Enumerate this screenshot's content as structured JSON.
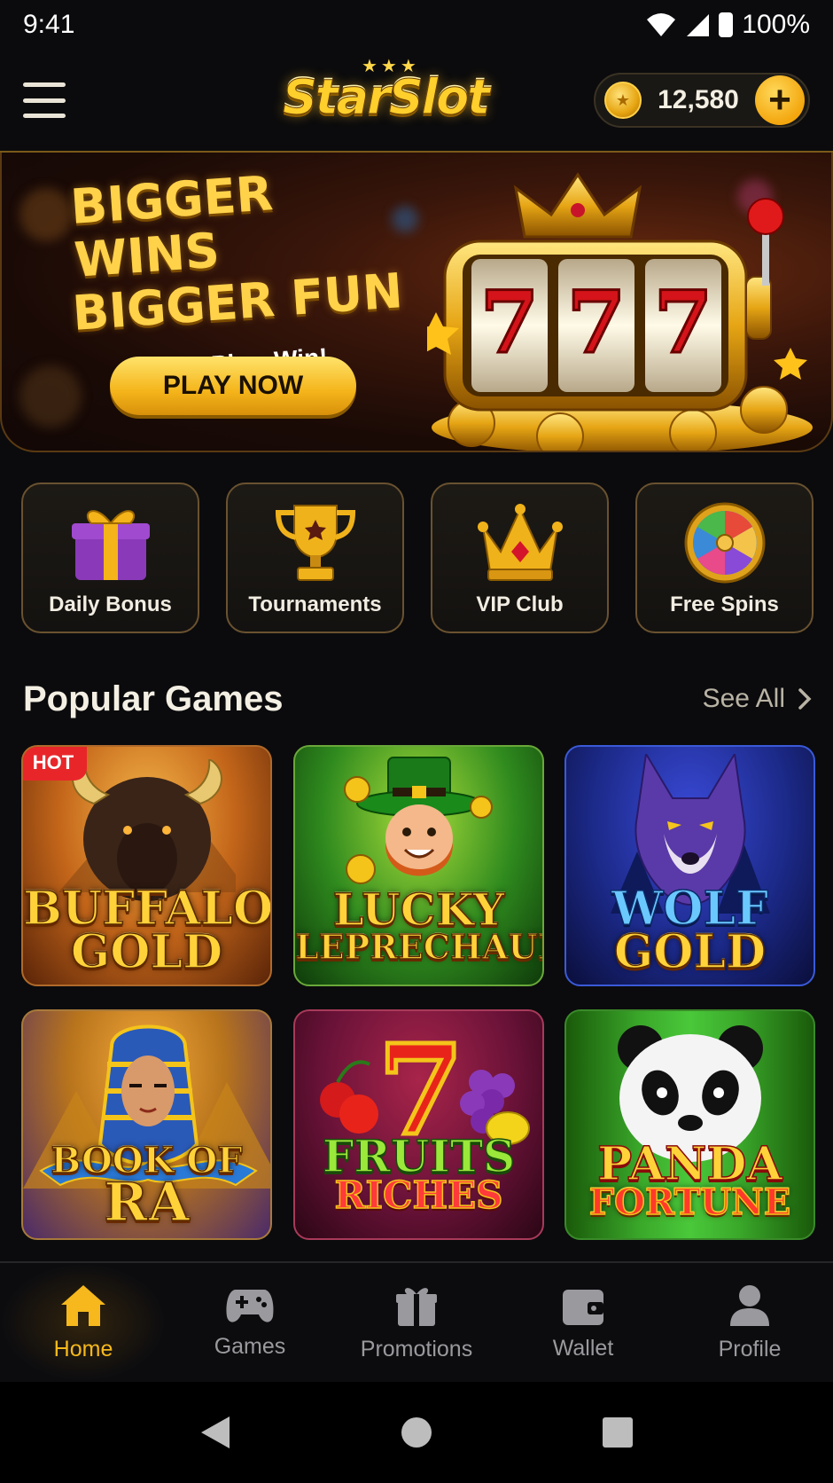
{
  "status_bar": {
    "time": "9:41",
    "battery": "100%"
  },
  "header": {
    "logo_text": "StarSlot",
    "balance": "12,580",
    "add_button": "+"
  },
  "hero": {
    "headline_line1": "BIGGER WINS",
    "headline_line2": "BIGGER FUN",
    "tagline": "Spin. Play. Win!",
    "cta_label": "PLAY NOW",
    "reel_symbols": [
      "7",
      "7",
      "7"
    ]
  },
  "quick_actions": [
    {
      "label": "Daily Bonus",
      "icon": "gift-icon"
    },
    {
      "label": "Tournaments",
      "icon": "trophy-icon"
    },
    {
      "label": "VIP Club",
      "icon": "crown-icon"
    },
    {
      "label": "Free Spins",
      "icon": "wheel-icon"
    }
  ],
  "popular": {
    "title": "Popular Games",
    "see_all": "See All"
  },
  "games": [
    {
      "line1": "BUFFALO",
      "line2": "GOLD",
      "badge": "HOT",
      "theme": "#c4661a"
    },
    {
      "line1": "LUCKY",
      "line2": "LEPRECHAUN",
      "theme": "#2f8a1e"
    },
    {
      "line1": "WOLF",
      "line2": "GOLD",
      "theme": "#1c2a8a"
    },
    {
      "line1": "BOOK OF",
      "line2": "RA",
      "theme": "#b8741c"
    },
    {
      "line1": "FRUITS",
      "line2": "RICHES",
      "theme": "#6a1238"
    },
    {
      "line1": "PANDA",
      "line2": "FORTUNE",
      "theme": "#2a7a1a"
    }
  ],
  "bottom_nav": [
    {
      "label": "Home",
      "icon": "home-icon",
      "active": true
    },
    {
      "label": "Games",
      "icon": "gamepad-icon"
    },
    {
      "label": "Promotions",
      "icon": "gift-icon"
    },
    {
      "label": "Wallet",
      "icon": "wallet-icon"
    },
    {
      "label": "Profile",
      "icon": "user-icon"
    }
  ],
  "colors": {
    "accent": "#f6b81c",
    "background": "#0b0b0d",
    "hot_badge": "#e8262a"
  }
}
